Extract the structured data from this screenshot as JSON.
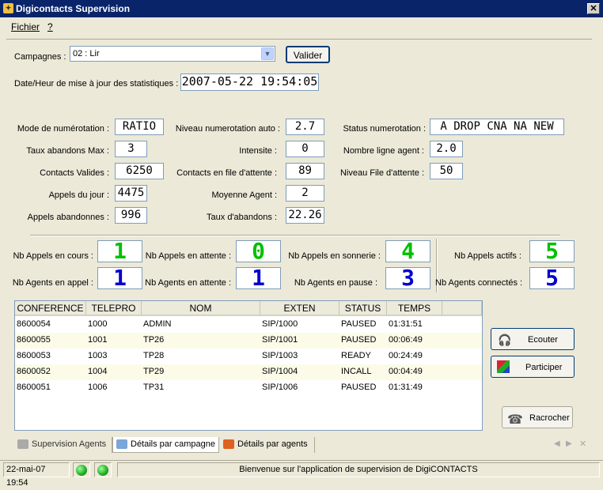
{
  "window": {
    "title": "Digicontacts Supervision",
    "close": "✕"
  },
  "menu": {
    "fichier": "Fichier",
    "help": "?"
  },
  "campagnes": {
    "label": "Campagnes :",
    "value": "02 : Lir",
    "valider": "Valider"
  },
  "stats_date": {
    "label": "Date/Heur de mise à jour des statistiques :",
    "value": "2007-05-22 19:54:05"
  },
  "fields": {
    "mode_label": "Mode de numérotation :",
    "mode": "RATIO",
    "abandons_max_label": "Taux abandons Max :",
    "abandons_max": "3",
    "contacts_valides_label": "Contacts Valides :",
    "contacts_valides": "6250",
    "appels_jour_label": "Appels du jour :",
    "appels_jour": "4475",
    "appels_abandonnes_label": "Appels abandonnes :",
    "appels_abandonnes": "996",
    "niveau_auto_label": "Niveau numerotation auto :",
    "niveau_auto": "2.7",
    "intensite_label": "Intensite :",
    "intensite": "0",
    "contacts_file_label": "Contacts en file d'attente :",
    "contacts_file": "89",
    "moyenne_agent_label": "Moyenne Agent :",
    "moyenne_agent": "2",
    "taux_abandons_label": "Taux d'abandons :",
    "taux_abandons": "22.26",
    "status_num_label": "Status numerotation :",
    "status_num": "A DROP CNA NA NEW",
    "nb_ligne_label": "Nombre ligne agent :",
    "nb_ligne": "2.0",
    "niveau_file_label": "Niveau File d'attente :",
    "niveau_file": "50"
  },
  "counters": {
    "appels_cours_label": "Nb Appels en cours :",
    "appels_cours": "1",
    "appels_attente_label": "Nb Appels en attente :",
    "appels_attente": "0",
    "appels_sonnerie_label": "Nb Appels en sonnerie :",
    "appels_sonnerie": "4",
    "appels_actifs_label": "Nb Appels actifs :",
    "appels_actifs": "5",
    "agents_appel_label": "Nb Agents en appel :",
    "agents_appel": "1",
    "agents_attente_label": "Nb Agents en attente :",
    "agents_attente": "1",
    "agents_pause_label": "Nb Agents en pause :",
    "agents_pause": "3",
    "agents_connectes_label": "Nb Agents connectés :",
    "agents_connectes": "5"
  },
  "table": {
    "columns": [
      "CONFERENCE",
      "TELEPRO",
      "NOM",
      "EXTEN",
      "STATUS",
      "TEMPS"
    ],
    "rows": [
      [
        "8600054",
        "1000",
        "ADMIN",
        "SIP/1000",
        "PAUSED",
        "01:31:51"
      ],
      [
        "8600055",
        "1001",
        "TP26",
        "SIP/1001",
        "PAUSED",
        "00:06:49"
      ],
      [
        "8600053",
        "1003",
        "TP28",
        "SIP/1003",
        "READY",
        "00:24:49"
      ],
      [
        "8600052",
        "1004",
        "TP29",
        "SIP/1004",
        "INCALL",
        "00:04:49"
      ],
      [
        "8600051",
        "1006",
        "TP31",
        "SIP/1006",
        "PAUSED",
        "01:31:49"
      ]
    ]
  },
  "buttons": {
    "ecouter": "Ecouter",
    "participer": "Participer",
    "racrocher": "Racrocher"
  },
  "tabs": [
    "Supervision Agents",
    "Détails par campagne",
    "Détails par agents"
  ],
  "statusbar": {
    "datetime": "22-mai-07 19:54",
    "message": "Bienvenue sur l'application de supervision de DigiCONTACTS"
  },
  "colors": {
    "green": "#00c000",
    "blue": "#0000d0",
    "titlebar": "#0a246a"
  }
}
